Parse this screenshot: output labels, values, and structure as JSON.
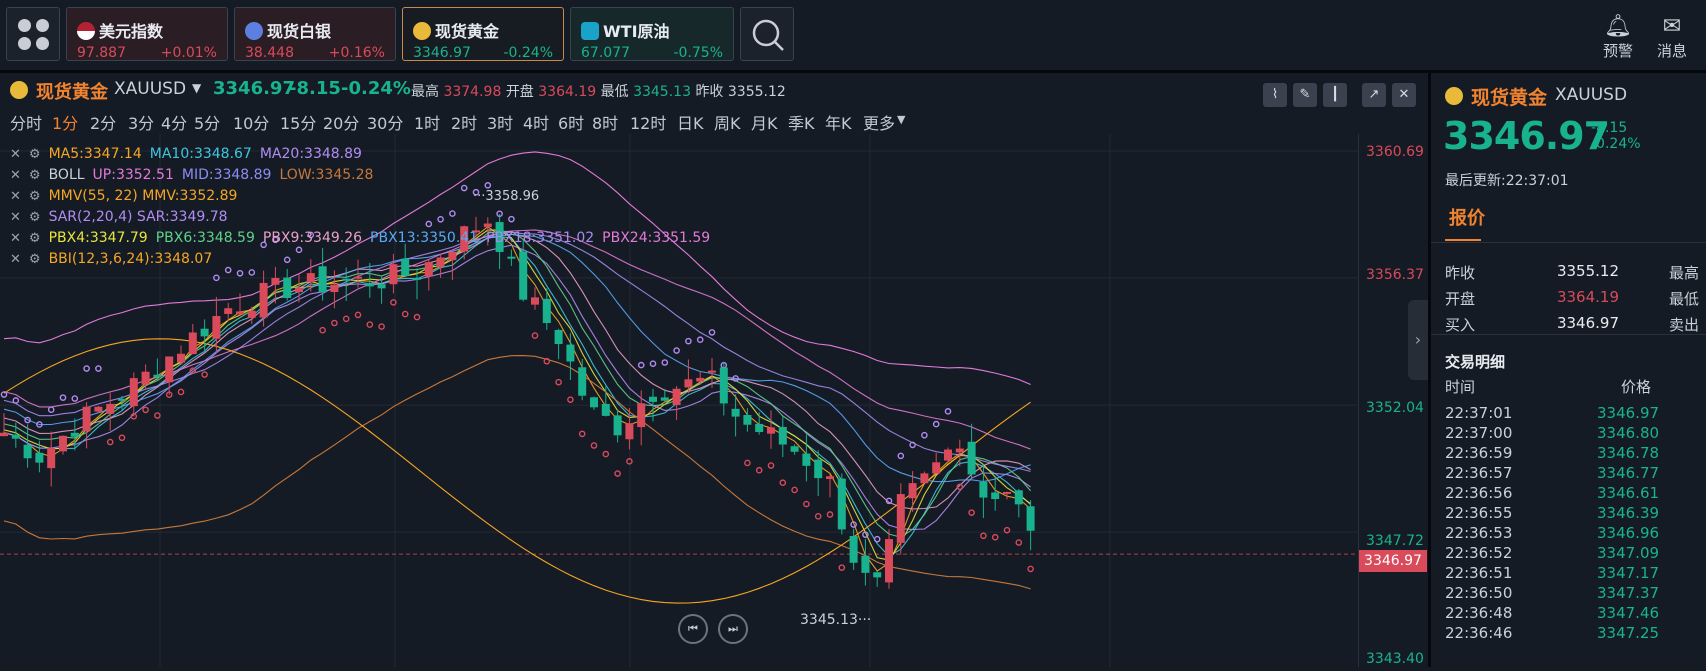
{
  "colors": {
    "up": "#d94a5b",
    "down": "#19b28f",
    "accent": "#f0832f",
    "gold": "#e9b93a"
  },
  "tickers": [
    {
      "name": "美元指数",
      "price": "97.887",
      "change": "+0.01%",
      "trend": "up",
      "icon": "us-flag-icon"
    },
    {
      "name": "现货白银",
      "price": "38.448",
      "change": "+0.16%",
      "trend": "up",
      "icon": "silver-icon"
    },
    {
      "name": "现货黄金",
      "price": "3346.97",
      "change": "-0.24%",
      "trend": "down",
      "icon": "gold-icon"
    },
    {
      "name": "WTI原油",
      "price": "67.077",
      "change": "-0.75%",
      "trend": "down",
      "icon": "oil-icon"
    }
  ],
  "top_actions": {
    "alert_label": "预警",
    "message_label": "消息"
  },
  "chart_header": {
    "name": "现货黄金",
    "symbol": "XAUUSD",
    "price": "3346.97",
    "change": "-8.15",
    "change_pct": "-0.24%",
    "high_label": "最高",
    "high": "3374.98",
    "open_label": "开盘",
    "open": "3364.19",
    "low_label": "最低",
    "low": "3345.13",
    "prev_label": "昨收",
    "prev": "3355.12"
  },
  "timeframes": [
    "分时",
    "1分",
    "2分",
    "3分",
    "4分",
    "5分",
    "10分",
    "15分",
    "20分",
    "30分",
    "1时",
    "2时",
    "3时",
    "4时",
    "6时",
    "8时",
    "12时",
    "日K",
    "周K",
    "月K",
    "季K",
    "年K",
    "更多"
  ],
  "active_timeframe": "1分",
  "indicators": [
    {
      "parts": [
        {
          "text": "MA5:3347.14",
          "color": "#f5a623"
        },
        {
          "text": "MA10:3348.67",
          "color": "#3ec6e0"
        },
        {
          "text": "MA20:3348.89",
          "color": "#b18cf2"
        }
      ]
    },
    {
      "parts": [
        {
          "text": "BOLL",
          "color": "#c9d1d9"
        },
        {
          "text": "UP:3352.51",
          "color": "#e27ad8"
        },
        {
          "text": "MID:3348.89",
          "color": "#8c8cf2"
        },
        {
          "text": "LOW:3345.28",
          "color": "#c7773a"
        }
      ]
    },
    {
      "parts": [
        {
          "text": "MMV(55, 22) MMV:3352.89",
          "color": "#f5a623"
        }
      ]
    },
    {
      "parts": [
        {
          "text": "SAR(2,20,4) SAR:3349.78",
          "color": "#b18cf2"
        }
      ]
    },
    {
      "parts": [
        {
          "text": "PBX4:3347.79",
          "color": "#e6e63a"
        },
        {
          "text": "PBX6:3348.59",
          "color": "#5fd38a"
        },
        {
          "text": "PBX9:3349.26",
          "color": "#e8a0c8"
        },
        {
          "text": "PBX13:3350.41",
          "color": "#5aa9f5"
        },
        {
          "text": "PBX18:3351.02",
          "color": "#a68cf2"
        },
        {
          "text": "PBX24:3351.59",
          "color": "#e27ad8"
        }
      ]
    },
    {
      "parts": [
        {
          "text": "BBI(12,3,6,24):3348.07",
          "color": "#f5a623"
        }
      ]
    }
  ],
  "price_scale": [
    "3360.69",
    "3356.37",
    "3352.04",
    "3347.72",
    "3343.40"
  ],
  "last_price_tag": "3346.97",
  "annotations": {
    "high_marker": "3358.96",
    "low_marker": "3345.13"
  },
  "panel": {
    "name": "现货黄金",
    "symbol": "XAUUSD",
    "price": "3346.97",
    "change": "-8.15",
    "change_pct": "-0.24%",
    "updated": "最后更新:22:37:01",
    "tab": "报价",
    "quote_rows": [
      {
        "label": "昨收",
        "value": "3355.12",
        "label2": "最高",
        "color": "#e8ecf1"
      },
      {
        "label": "开盘",
        "value": "3364.19",
        "label2": "最低",
        "color": "#d94a5b"
      },
      {
        "label": "买入",
        "value": "3346.97",
        "label2": "卖出",
        "color": "#e8ecf1"
      }
    ],
    "trades_title": "交易明细",
    "trades_headers": {
      "time": "时间",
      "price": "价格"
    },
    "trades": [
      {
        "time": "22:37:01",
        "price": "3346.97"
      },
      {
        "time": "22:37:00",
        "price": "3346.80"
      },
      {
        "time": "22:36:59",
        "price": "3346.78"
      },
      {
        "time": "22:36:57",
        "price": "3346.77"
      },
      {
        "time": "22:36:56",
        "price": "3346.61"
      },
      {
        "time": "22:36:55",
        "price": "3346.39"
      },
      {
        "time": "22:36:53",
        "price": "3346.96"
      },
      {
        "time": "22:36:52",
        "price": "3347.09"
      },
      {
        "time": "22:36:51",
        "price": "3347.17"
      },
      {
        "time": "22:36:50",
        "price": "3347.37"
      },
      {
        "time": "22:36:48",
        "price": "3347.46"
      },
      {
        "time": "22:36:46",
        "price": "3347.25"
      }
    ]
  }
}
